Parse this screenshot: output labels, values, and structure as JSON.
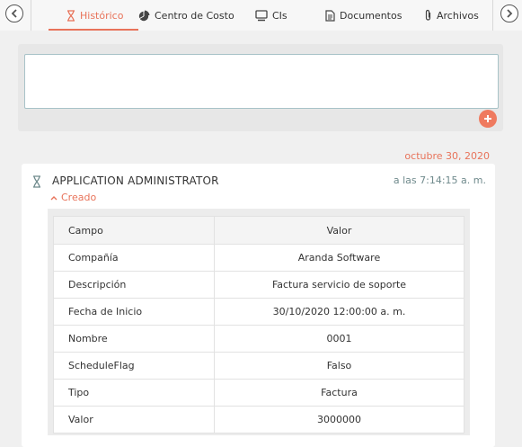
{
  "tabs": [
    {
      "label": "Histórico",
      "icon": "hourglass-icon",
      "active": true
    },
    {
      "label": "Centro de Costo",
      "icon": "pie-chart-icon",
      "active": false
    },
    {
      "label": "CIs",
      "icon": "monitor-icon",
      "active": false
    },
    {
      "label": "Documentos",
      "icon": "document-icon",
      "active": false
    },
    {
      "label": "Archivos",
      "icon": "paperclip-icon",
      "active": false
    }
  ],
  "comment": {
    "value": "",
    "placeholder": ""
  },
  "history": {
    "date": "octubre 30, 2020",
    "entry": {
      "author": "APPLICATION ADMINISTRATOR",
      "time": "a las 7:14:15 a. m.",
      "status": "Creado",
      "table": {
        "headers": [
          "Campo",
          "Valor"
        ],
        "rows": [
          [
            "Compañía",
            "Aranda Software"
          ],
          [
            "Descripción",
            "Factura servicio de soporte"
          ],
          [
            "Fecha de Inicio",
            "30/10/2020 12:00:00 a. m."
          ],
          [
            "Nombre",
            "0001"
          ],
          [
            "ScheduleFlag",
            "Falso"
          ],
          [
            "Tipo",
            "Factura"
          ],
          [
            "Valor",
            "3000000"
          ]
        ]
      }
    }
  },
  "colors": {
    "accent": "#e8735a",
    "teal": "#6f8a8c"
  }
}
